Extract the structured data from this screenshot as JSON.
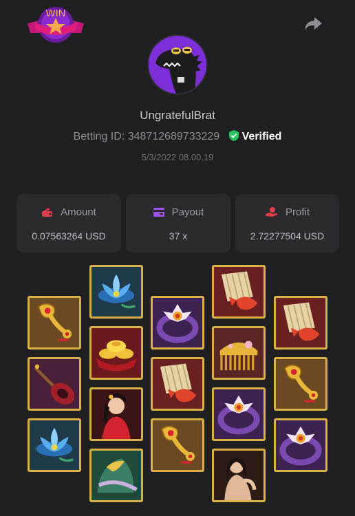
{
  "header": {
    "badge_text": "WIN",
    "share_icon": "share-arrow-icon"
  },
  "profile": {
    "avatar_icon": "crocodile-avatar-icon",
    "username": "UngratefulBrat",
    "betting_id_label": "Betting ID:",
    "betting_id": "348712689733229",
    "verified_label": "Verified",
    "date": "5/3/2022 08.00.19"
  },
  "stats": {
    "amount": {
      "icon": "wallet-icon",
      "label": "Amount",
      "value": "0.07563264 USD"
    },
    "payout": {
      "icon": "card-icon",
      "label": "Payout",
      "value": "37 x"
    },
    "profit": {
      "icon": "profit-hand-icon",
      "label": "Profit",
      "value": "2.72277504 USD"
    }
  },
  "colors": {
    "background": "#1f1f22",
    "card": "#2a2a2e",
    "tile_border": "#d9b245",
    "verified_green": "#22c55e",
    "accent_red": "#e23b4a",
    "accent_purple": "#a052e8"
  },
  "reels": [
    [
      "ruyi-scepter",
      "pipa",
      "lotus-blue"
    ],
    [
      "lotus-blue",
      "gold-ingots",
      "lady-in-red",
      "fan-leaf"
    ],
    [
      "jade-ring",
      "bamboo-scroll-koi",
      "ruyi-scepter"
    ],
    [
      "bamboo-scroll-koi",
      "ornate-comb",
      "jade-ring",
      "lady-portrait"
    ],
    [
      "bamboo-scroll-koi",
      "ruyi-scepter",
      "jade-ring"
    ]
  ]
}
